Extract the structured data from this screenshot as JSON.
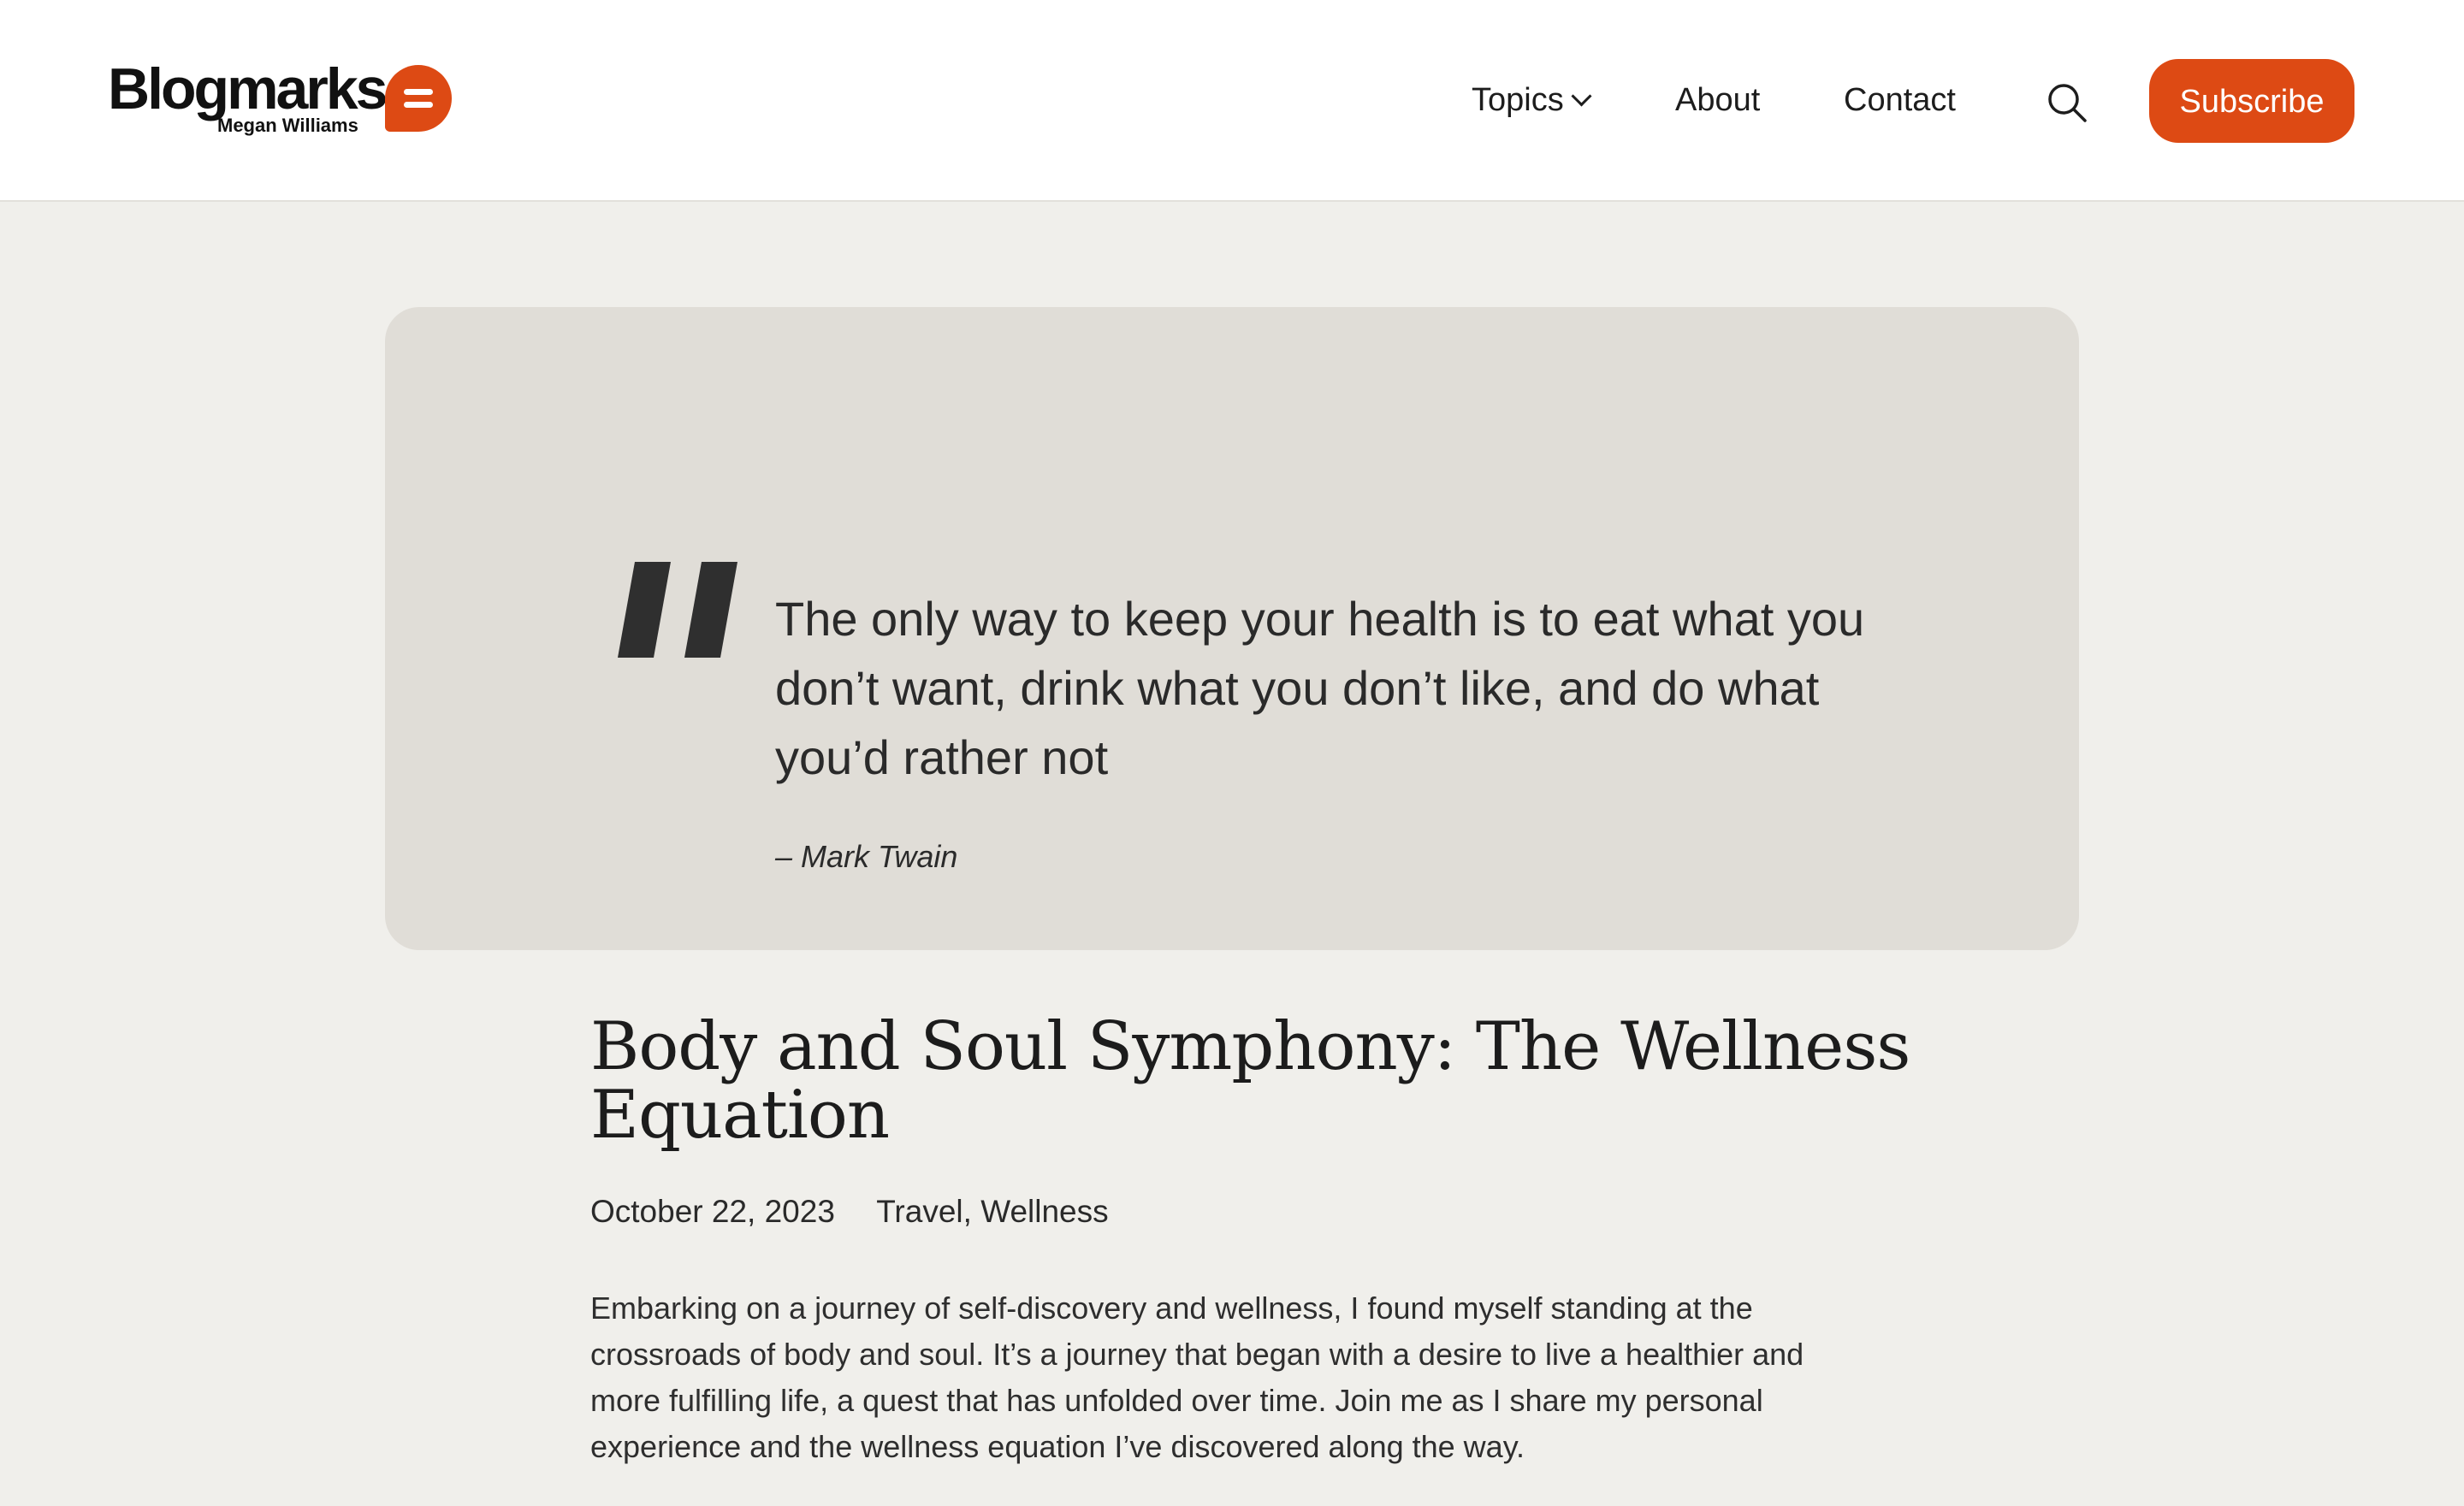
{
  "header": {
    "logo_name": "Blogmarks",
    "logo_author": "Megan Williams",
    "nav": {
      "topics": "Topics",
      "about": "About",
      "contact": "Contact"
    },
    "subscribe_label": "Subscribe",
    "search_icon": "search-icon",
    "accent_color": "#dd4a14"
  },
  "quote": {
    "text": "The only way to keep your health is to eat what you don’t want, drink what you don’t like, and do what you’d rather not",
    "author": "– Mark Twain"
  },
  "post": {
    "title": "Body and Soul Symphony: The Wellness Equation",
    "date": "October 22, 2023",
    "category_1": "Travel",
    "category_separator": ",",
    "category_2": "Wellness",
    "excerpt": "Embarking on a journey of self-discovery and wellness, I found myself standing at the crossroads of body and soul. It’s a journey that began with a desire to live a healthier and more fulfilling life, a quest that has unfolded over time. Join me as I share my personal experience and the wellness equation I’ve discovered along the way."
  }
}
